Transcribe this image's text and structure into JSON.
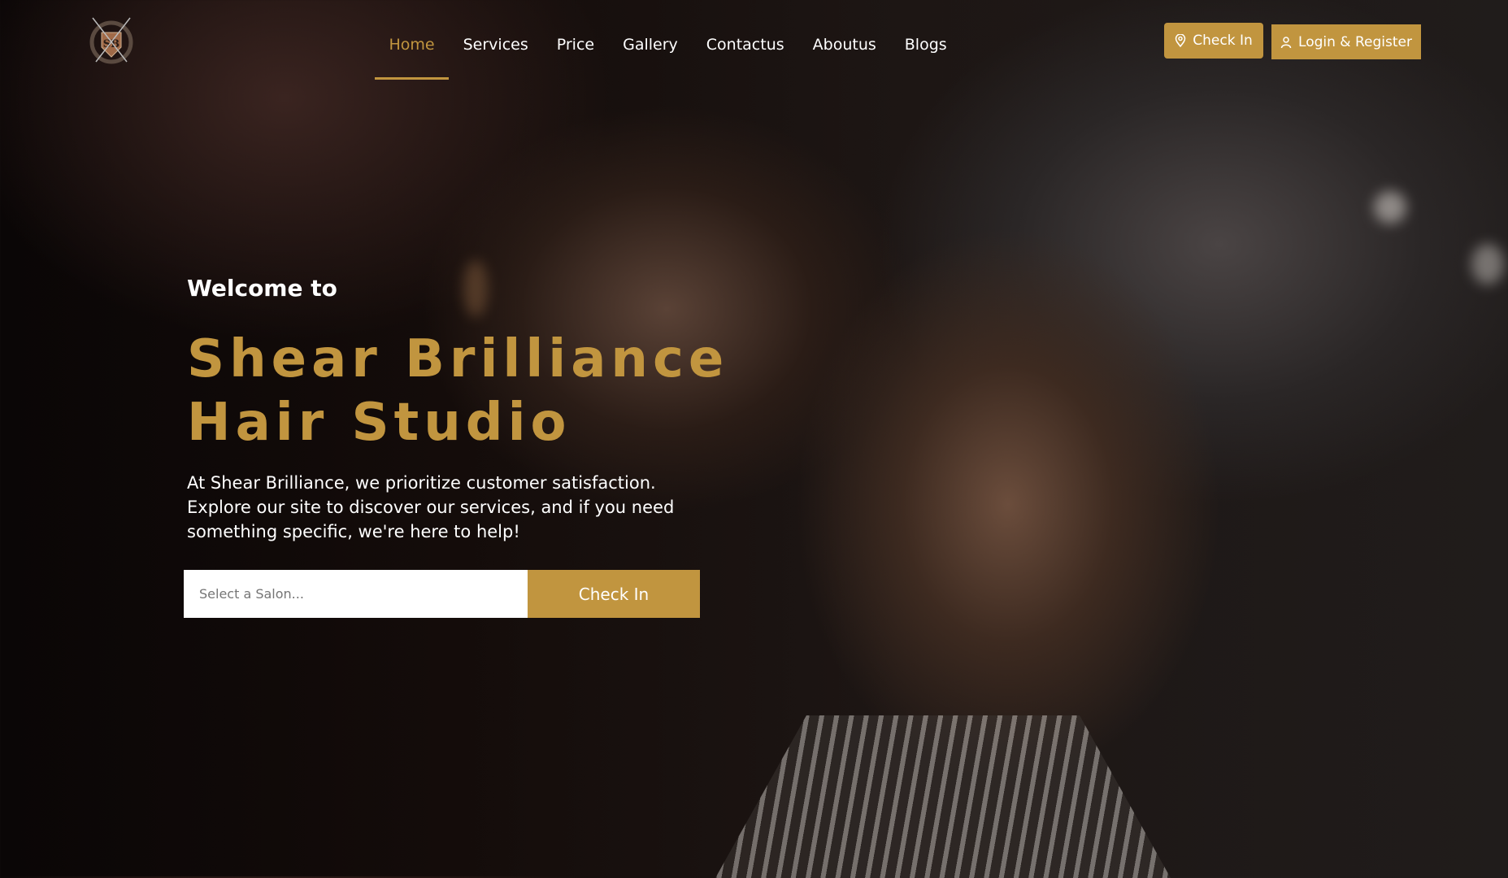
{
  "brand": {
    "logo_text": "SB",
    "name": "Shear Brilliance"
  },
  "nav": {
    "items": [
      {
        "label": "Home",
        "active": true
      },
      {
        "label": "Services"
      },
      {
        "label": "Price"
      },
      {
        "label": "Gallery"
      },
      {
        "label": "Contactus"
      },
      {
        "label": "Aboutus"
      },
      {
        "label": "Blogs"
      }
    ]
  },
  "header": {
    "checkin_label": "Check In",
    "checkin_icon": "map-pin-icon",
    "login_label": "Login & Register",
    "login_icon": "user-icon"
  },
  "hero": {
    "welcome": "Welcome to",
    "title_line1": "Shear Brilliance",
    "title_line2": "Hair Studio",
    "description": "At Shear Brilliance, we prioritize customer satisfaction. Explore our site to discover our services, and if you need something specific, we're here to help!"
  },
  "checkin_form": {
    "salon_placeholder": "Select a Salon...",
    "button_label": "Check In"
  },
  "colors": {
    "accent": "#c1953f"
  }
}
